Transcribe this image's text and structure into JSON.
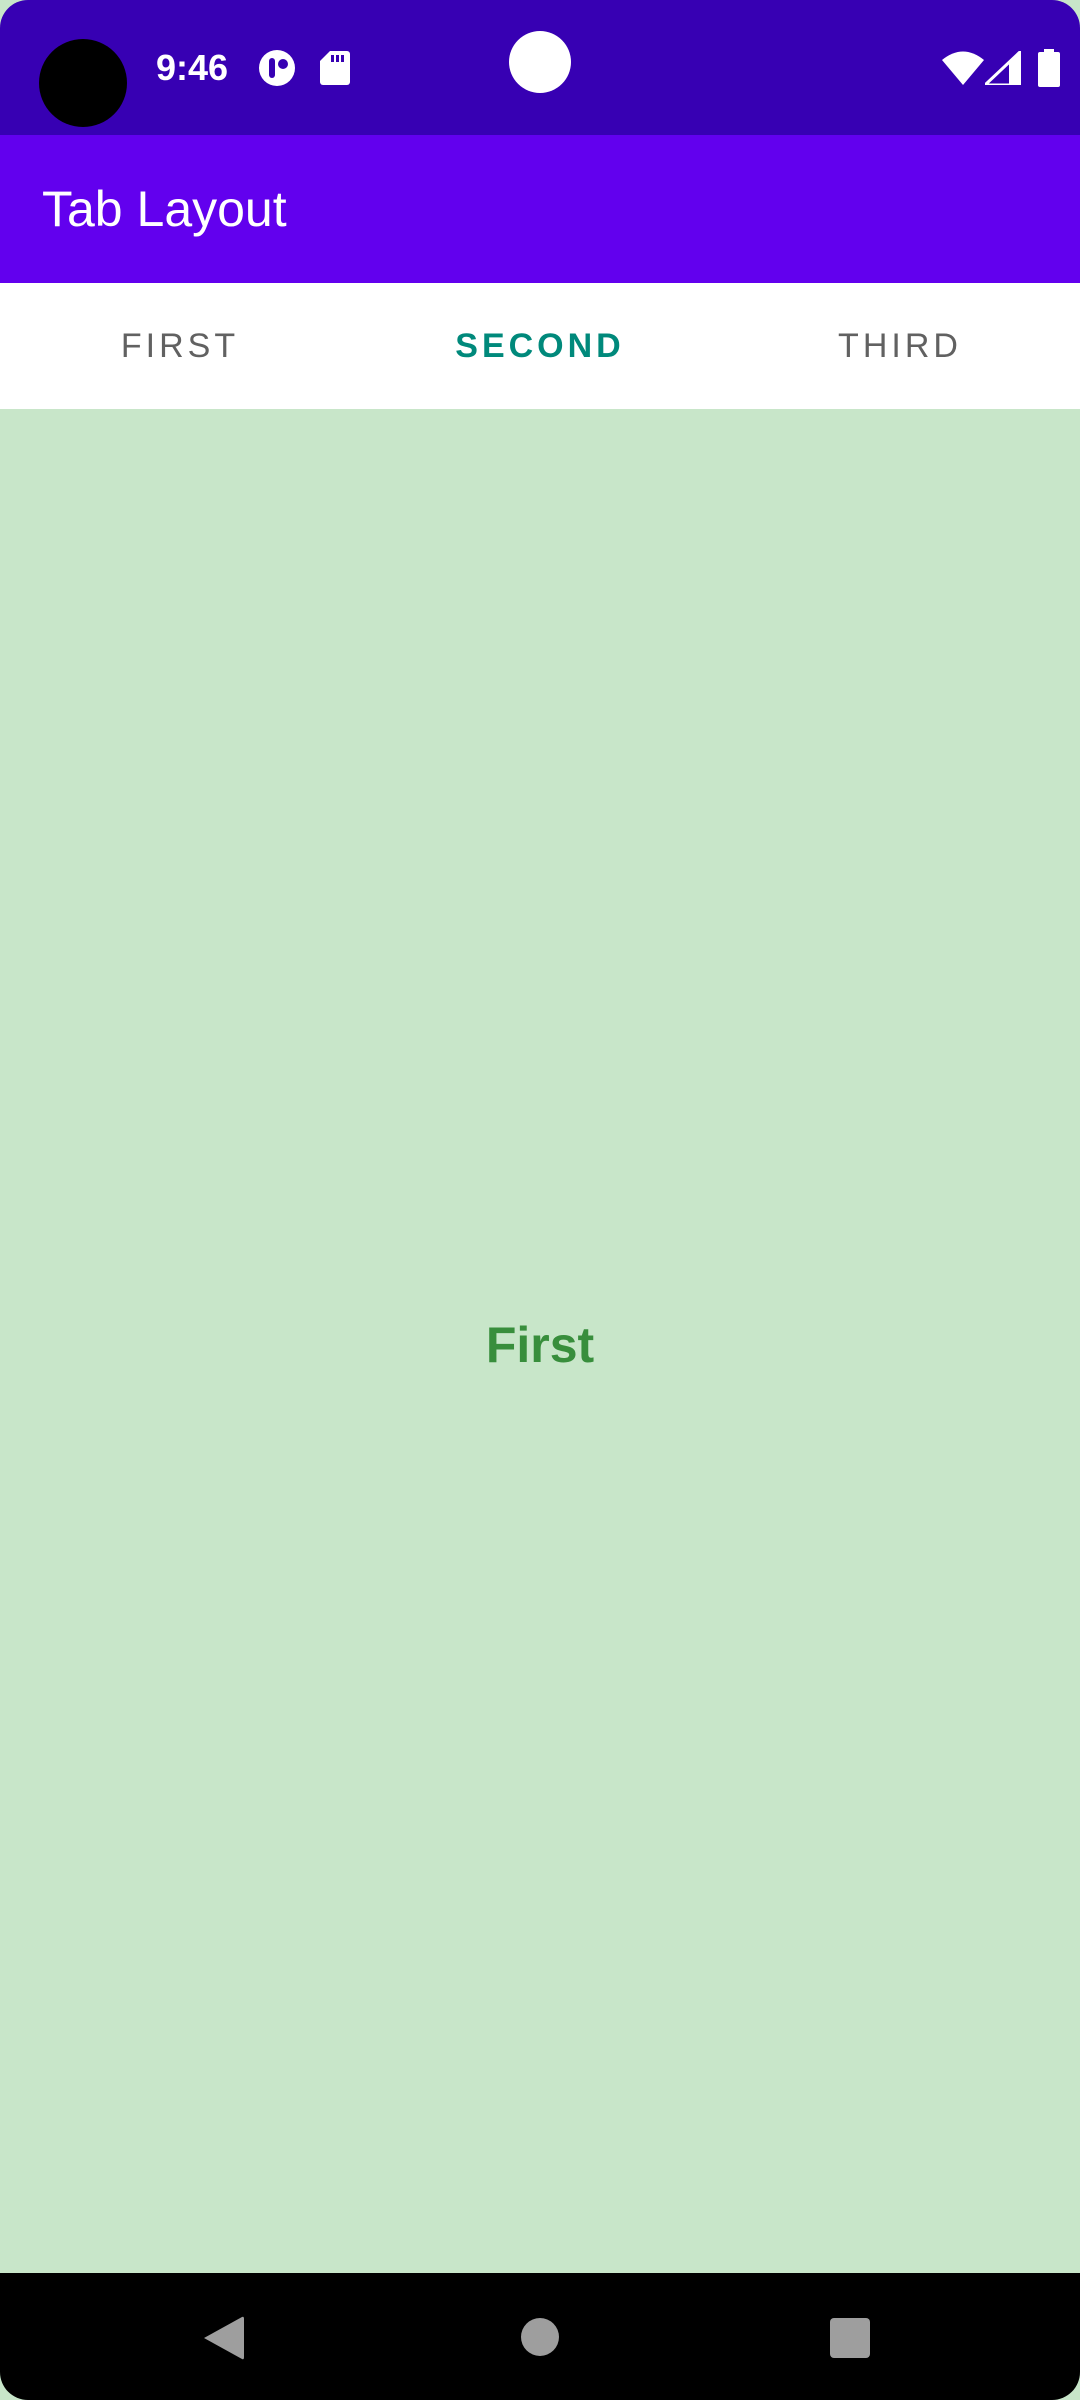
{
  "status_bar": {
    "time": "9:46",
    "icons": [
      "camera-cutout",
      "data-saver-icon",
      "sd-card-icon",
      "wifi-icon",
      "signal-icon",
      "battery-icon"
    ],
    "background": "#3700b3"
  },
  "app_bar": {
    "title": "Tab Layout",
    "background": "#6200ee"
  },
  "tabs": [
    {
      "label": "FIRST",
      "selected": false
    },
    {
      "label": "SECOND",
      "selected": true
    },
    {
      "label": "THIRD",
      "selected": false
    }
  ],
  "content": {
    "text": "First",
    "background": "#c8e6c9",
    "text_color": "#388e3c"
  },
  "nav_bar": {
    "buttons": [
      "back-icon",
      "home-icon",
      "recents-icon"
    ]
  },
  "colors": {
    "tab_selected": "#00897b",
    "tab_unselected": "#616161"
  }
}
